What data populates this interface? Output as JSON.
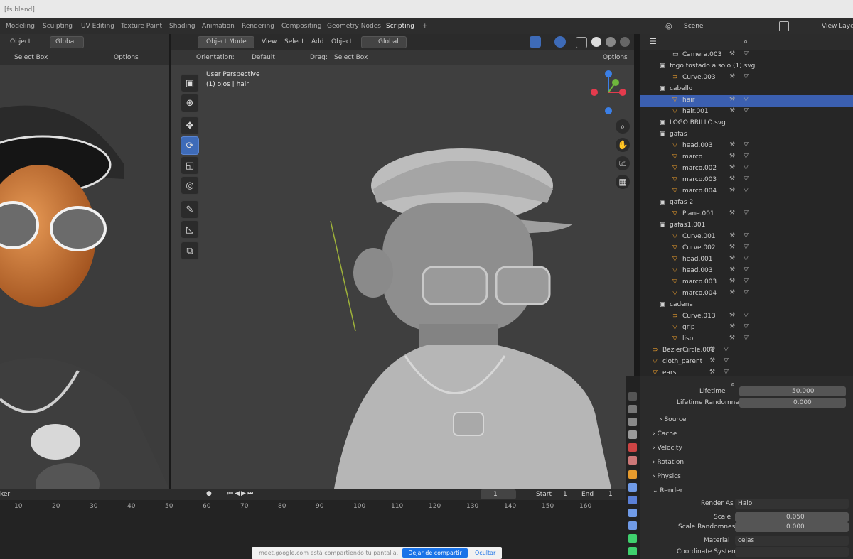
{
  "window": {
    "title": "[fs.blend]"
  },
  "workspace_tabs": [
    "Modeling",
    "Sculpting",
    "UV Editing",
    "Texture Paint",
    "Shading",
    "Animation",
    "Rendering",
    "Compositing",
    "Geometry Nodes",
    "Scripting",
    "+"
  ],
  "top_right": {
    "scene": "Scene",
    "view_layer": "View Layer"
  },
  "left_view": {
    "header": [
      "Object",
      "Global",
      "Select Box",
      "Options"
    ]
  },
  "main_view": {
    "header": {
      "mode": "Object Mode",
      "view": "View",
      "select": "Select",
      "add": "Add",
      "object": "Object",
      "transform": "Global"
    },
    "subheader": {
      "orientation_label": "Orientation:",
      "orientation_value": "Default",
      "drag_label": "Drag:",
      "drag_value": "Select Box",
      "options": "Options"
    },
    "overlay_title": "User Perspective",
    "overlay_sub": "(1) ojos | hair"
  },
  "outliner": {
    "rows": [
      {
        "label": "Camera.003",
        "indent": 46,
        "type": "camera"
      },
      {
        "label": "fogo tostado a solo (1).svg",
        "indent": 28,
        "type": "collection"
      },
      {
        "label": "Curve.003",
        "indent": 46,
        "type": "curve"
      },
      {
        "label": "cabello",
        "indent": 28,
        "type": "collection"
      },
      {
        "label": "hair",
        "indent": 46,
        "type": "mesh",
        "selected": true
      },
      {
        "label": "hair.001",
        "indent": 46,
        "type": "mesh"
      },
      {
        "label": "LOGO BRILLO.svg",
        "indent": 28,
        "type": "collection"
      },
      {
        "label": "gafas",
        "indent": 28,
        "type": "collection"
      },
      {
        "label": "head.003",
        "indent": 46,
        "type": "mesh"
      },
      {
        "label": "marco",
        "indent": 46,
        "type": "mesh"
      },
      {
        "label": "marco.002",
        "indent": 46,
        "type": "mesh"
      },
      {
        "label": "marco.003",
        "indent": 46,
        "type": "mesh"
      },
      {
        "label": "marco.004",
        "indent": 46,
        "type": "mesh"
      },
      {
        "label": "gafas 2",
        "indent": 28,
        "type": "collection"
      },
      {
        "label": "Plane.001",
        "indent": 46,
        "type": "mesh"
      },
      {
        "label": "gafas1.001",
        "indent": 28,
        "type": "collection"
      },
      {
        "label": "Curve.001",
        "indent": 46,
        "type": "mesh"
      },
      {
        "label": "Curve.002",
        "indent": 46,
        "type": "mesh"
      },
      {
        "label": "head.001",
        "indent": 46,
        "type": "mesh"
      },
      {
        "label": "head.003",
        "indent": 46,
        "type": "mesh"
      },
      {
        "label": "marco.003",
        "indent": 46,
        "type": "mesh"
      },
      {
        "label": "marco.004",
        "indent": 46,
        "type": "mesh"
      },
      {
        "label": "cadena",
        "indent": 28,
        "type": "collection"
      },
      {
        "label": "Curve.013",
        "indent": 46,
        "type": "curve"
      },
      {
        "label": "grip",
        "indent": 46,
        "type": "mesh"
      },
      {
        "label": "liso",
        "indent": 46,
        "type": "mesh"
      },
      {
        "label": "BezierCircle.001",
        "indent": 18,
        "type": "curve"
      },
      {
        "label": "cloth_parent",
        "indent": 18,
        "type": "mesh"
      },
      {
        "label": "ears",
        "indent": 18,
        "type": "mesh"
      }
    ]
  },
  "properties": {
    "lifetime_label": "Lifetime",
    "lifetime_value": "50.000",
    "lifetime_rand_label": "Lifetime Randomness",
    "lifetime_rand_value": "0.000",
    "sections": [
      "Source",
      "Cache",
      "Velocity",
      "Rotation",
      "Physics",
      "Render"
    ],
    "render_as_label": "Render As",
    "render_as_value": "Halo",
    "scale_label": "Scale",
    "scale_value": "0.050",
    "scale_rand_label": "Scale Randomness",
    "scale_rand_value": "0.000",
    "material_label": "Material",
    "material_value": "cejas",
    "coord_label": "Coordinate System"
  },
  "timeline": {
    "ticks": [
      "10",
      "20",
      "30",
      "40",
      "50",
      "60",
      "70",
      "80",
      "90",
      "100",
      "110",
      "120",
      "130",
      "140",
      "150",
      "160"
    ],
    "current": "1",
    "start_label": "Start",
    "start_value": "1",
    "end_label": "End",
    "end_value": "1",
    "left_label": "ker"
  },
  "sharebar": {
    "message": "meet.google.com está compartiendo tu pantalla.",
    "stop_button": "Dejar de compartir",
    "hide": "Ocultar"
  }
}
